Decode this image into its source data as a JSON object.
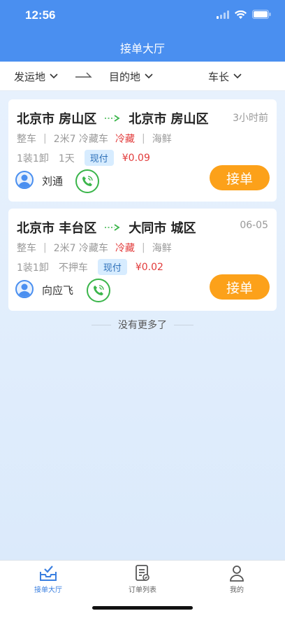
{
  "status": {
    "time": "12:56"
  },
  "nav": {
    "title": "接单大厅"
  },
  "filters": {
    "origin": "发运地",
    "destination": "目的地",
    "vehicle_length": "车长"
  },
  "orders": [
    {
      "from": "北京市 房山区",
      "to": "北京市 房山区",
      "time": "3小时前",
      "load_type": "整车",
      "vehicle": "2米7 冷藏车",
      "temp_type": "冷藏",
      "cargo": "海鲜",
      "load_unload": "1装1卸",
      "extra": "1天",
      "payment": "现付",
      "price": "¥0.09",
      "contact": "刘通",
      "accept_label": "接单"
    },
    {
      "from": "北京市 丰台区",
      "to": "大同市 城区",
      "time": "06-05",
      "load_type": "整车",
      "vehicle": "2米7 冷藏车",
      "temp_type": "冷藏",
      "cargo": "海鲜",
      "load_unload": "1装1卸",
      "extra": "不押车",
      "payment": "现付",
      "price": "¥0.02",
      "contact": "向应飞",
      "accept_label": "接单"
    }
  ],
  "list_end": "没有更多了",
  "tabs": [
    {
      "label": "接单大厅",
      "icon": "inbox-check-icon",
      "active": true
    },
    {
      "label": "订单列表",
      "icon": "document-list-icon",
      "active": false
    },
    {
      "label": "我的",
      "icon": "user-icon",
      "active": false
    }
  ],
  "colors": {
    "primary": "#4a8ff0",
    "accept": "#fca11a",
    "price": "#e23b3b",
    "phone": "#3ab54a"
  }
}
